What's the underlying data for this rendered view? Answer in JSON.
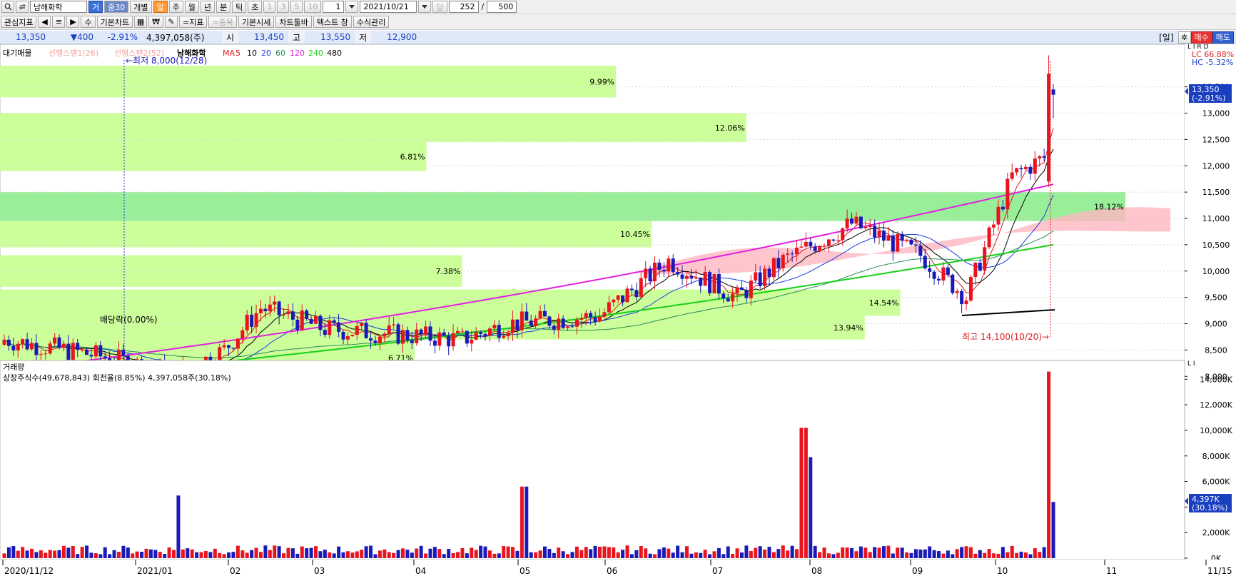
{
  "toolbar": {
    "stock_name": "남해화학",
    "btn_geo": "거",
    "btn_gyo": "중30",
    "btn_individual": "개별",
    "period_day": "일",
    "period_week": "주",
    "period_month": "월",
    "period_year": "년",
    "period_minute": "분",
    "period_tick": "틱",
    "period_second": "초",
    "num_1": "1",
    "num_3": "3",
    "num_5": "5",
    "num_10": "10",
    "interval_value": "1",
    "date": "2021/10/21",
    "dang_label": "당",
    "count_value": "252",
    "slash": "/",
    "total_value": "500"
  },
  "toolbar2": {
    "watch_indicator": "관심지표",
    "btn_su": "수",
    "basic_chart": "기본차트",
    "won": "₩",
    "indicator": "=지표",
    "stock": "=종목",
    "basic_price": "기본시세",
    "chart_toolbar": "차트툴바",
    "text_window": "텍스트 창",
    "formula": "수식관리"
  },
  "quote": {
    "price": "13,350",
    "change": "▼400",
    "change_pct": "-2.91%",
    "volume": "4,397,058(주)",
    "open_label": "시",
    "open": "13,450",
    "high_label": "고",
    "high": "13,550",
    "low_label": "저",
    "low": "12,900",
    "period_tag": "[일]",
    "buy": "매수",
    "sell": "매도"
  },
  "price_legend": {
    "supply": "대기매물",
    "span1": "선행스팬1(26)",
    "span2": "선행스팬2(52)",
    "stock_name": "남해화학",
    "ma_label": "MA",
    "ma5": "5",
    "ma10": "10",
    "ma20": "20",
    "ma60": "60",
    "ma120": "120",
    "ma240": "240",
    "ma480": "480"
  },
  "annotations": {
    "low": "←최저 8,000(12/28)",
    "high": "최고 14,100(10/20)→",
    "dividend": "배당락(0.00%)",
    "lc": "LC 66.88%",
    "hc": "HC -5.32%",
    "lrd": "L I R D",
    "cur_price": "13,350",
    "cur_pct": "(-2.91%)"
  },
  "volume_legend": {
    "title": "거래량",
    "info": "상장주식수(49,678,843) 회전율(8.85%) 4,397,058주(30.18%)",
    "cur_vol": "4,397K",
    "cur_pct": "(30.18%)",
    "li": "L I"
  },
  "colors": {
    "up": "#e8141e",
    "down": "#1a1ab8",
    "ma5": "#e0141e",
    "ma10": "#000000",
    "ma20": "#1c3ce0",
    "ma60": "#2c8a5a",
    "ma120": "#e020e0",
    "ma240": "#18d018",
    "supply_band": "#ccff99",
    "supply_band_max": "#99ee99",
    "cloud": "#ffb6c1"
  },
  "chart_data": [
    {
      "type": "candlestick",
      "title": "남해화학",
      "y_ticks": [
        "13,500",
        "13,000",
        "12,500",
        "12,000",
        "11,500",
        "11,000",
        "10,500",
        "10,000",
        "9,500",
        "9,000",
        "8,500",
        "8,000"
      ],
      "ylim": [
        7800,
        14200
      ],
      "x_ticks": [
        "2020/11/12",
        "2021/01",
        "02",
        "03",
        "04",
        "05",
        "06",
        "07",
        "08",
        "09",
        "10",
        "11",
        "11/15"
      ],
      "supply_bands": [
        {
          "lo": 13300,
          "hi": 13900,
          "pct": "9.99%",
          "extent": 0.52
        },
        {
          "lo": 12450,
          "hi": 13000,
          "pct": "12.06%",
          "extent": 0.63
        },
        {
          "lo": 11900,
          "hi": 12450,
          "pct": "6.81%",
          "extent": 0.36
        },
        {
          "lo": 10950,
          "hi": 11500,
          "pct": "18.12%",
          "extent": 0.95
        },
        {
          "lo": 10450,
          "hi": 10950,
          "pct": "10.45%",
          "extent": 0.55
        },
        {
          "lo": 9700,
          "hi": 10300,
          "pct": "7.38%",
          "extent": 0.39
        },
        {
          "lo": 9150,
          "hi": 9650,
          "pct": "14.54%",
          "extent": 0.76
        },
        {
          "lo": 8700,
          "hi": 9150,
          "pct": "13.94%",
          "extent": 0.73
        },
        {
          "lo": 8000,
          "hi": 8700,
          "pct": "6.71%",
          "extent": 0.35
        }
      ],
      "ohlc_first": {
        "o": 8600,
        "h": 9000,
        "l": 8450,
        "c": 8800
      },
      "last": {
        "o": 13450,
        "h": 13550,
        "l": 12900,
        "c": 13350
      },
      "prev": {
        "o": 11700,
        "h": 14100,
        "l": 11600,
        "c": 13750
      },
      "high": {
        "value": 14100,
        "date": "10/20"
      },
      "low": {
        "value": 8000,
        "date": "12/28"
      }
    },
    {
      "type": "bar",
      "title": "거래량",
      "y_ticks": [
        "14,000K",
        "12,000K",
        "10,000K",
        "8,000K",
        "6,000K",
        "4,000K",
        "2,000K",
        "0K"
      ],
      "ylim": [
        0,
        14800
      ],
      "peaks": [
        {
          "x_frac": 0.148,
          "value": 4900
        },
        {
          "x_frac": 0.44,
          "value": 5600
        },
        {
          "x_frac": 0.678,
          "value": 10200
        },
        {
          "x_frac": 0.683,
          "value": 7900
        },
        {
          "x_frac": 0.886,
          "value": 14600
        },
        {
          "x_frac": 0.89,
          "value": 4397
        }
      ]
    }
  ]
}
